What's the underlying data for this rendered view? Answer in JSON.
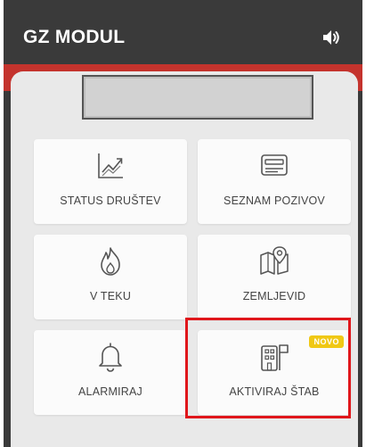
{
  "header": {
    "title": "GZ MODUL",
    "sound_icon": "speaker-volume-icon"
  },
  "colors": {
    "topbar": "#3a3a3a",
    "accent_red": "#c4332d",
    "highlight_red": "#e0161b",
    "badge_yellow": "#f0c814",
    "panel": "#e9e9e9"
  },
  "tiles": [
    {
      "label": "STATUS DRUŠTEV",
      "icon": "trend-chart-icon"
    },
    {
      "label": "SEZNAM POZIVOV",
      "icon": "card-list-icon"
    },
    {
      "label": "V TEKU",
      "icon": "fire-icon"
    },
    {
      "label": "ZEMLJEVID",
      "icon": "map-pin-icon"
    },
    {
      "label": "ALARMIRAJ",
      "icon": "bell-icon"
    },
    {
      "label": "AKTIVIRAJ ŠTAB",
      "icon": "building-flag-icon",
      "badge": "NOVO"
    }
  ]
}
